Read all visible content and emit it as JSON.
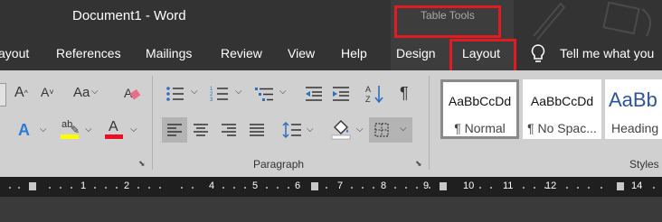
{
  "window": {
    "document_title": "Document1  -  Word",
    "context_group": "Table Tools"
  },
  "tabs": [
    {
      "label": "ayout"
    },
    {
      "label": "References"
    },
    {
      "label": "Mailings"
    },
    {
      "label": "Review"
    },
    {
      "label": "View"
    },
    {
      "label": "Help"
    },
    {
      "label": "Design"
    },
    {
      "label": "Layout"
    }
  ],
  "tell_me": "Tell me what you",
  "font_group": {
    "grow_font": "A",
    "shrink_font": "A",
    "change_case": "Aa",
    "text_effects": "A",
    "highlight": "ab",
    "font_color": "A"
  },
  "paragraph_group": {
    "label": "Paragraph",
    "pilcrow": "¶"
  },
  "styles": {
    "label": "Styles",
    "items": [
      {
        "sample": "AaBbCcDd",
        "name": "¶ Normal"
      },
      {
        "sample": "AaBbCcDd",
        "name": "¶ No Spac..."
      },
      {
        "sample": "AaBb",
        "name": "Heading"
      }
    ]
  },
  "ruler": {
    "numbers": [
      "1",
      "2",
      "4",
      "5",
      "6",
      "7",
      "8",
      "9",
      "10",
      "11",
      "12",
      "14"
    ]
  },
  "colors": {
    "highlight": "#ffff00",
    "font_color": "#e81123",
    "callout": "#e11b22"
  }
}
